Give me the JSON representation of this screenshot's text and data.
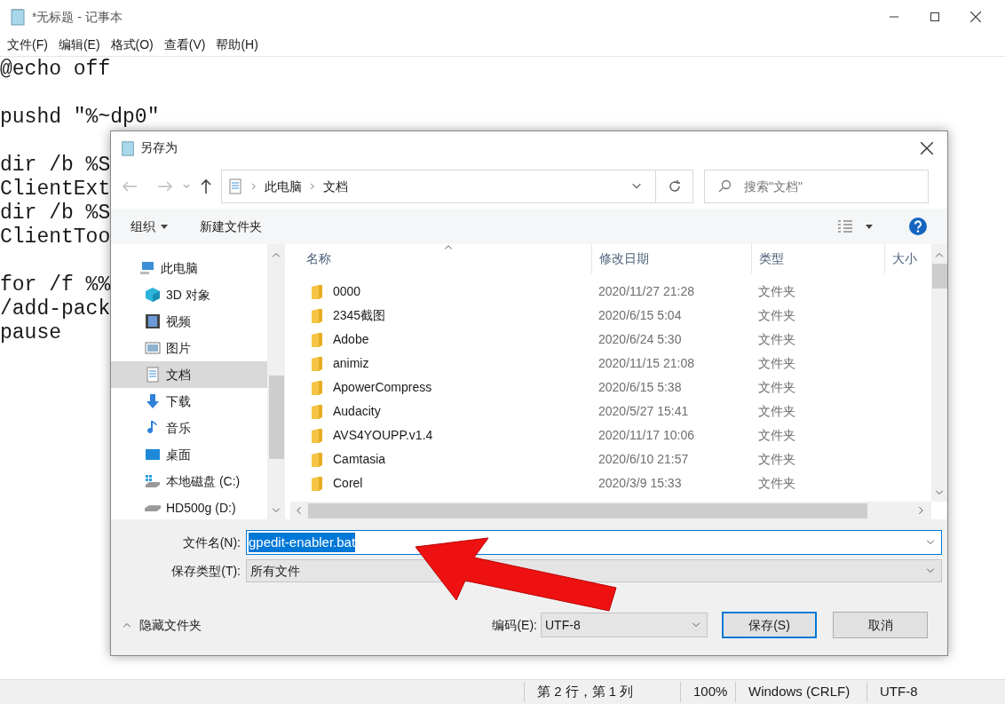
{
  "window": {
    "title": "*无标题 - 记事本"
  },
  "menu": [
    "文件(F)",
    "编辑(E)",
    "格式(O)",
    "查看(V)",
    "帮助(H)"
  ],
  "editor_paragraphs": [
    [
      "@echo off"
    ],
    [
      "pushd \"%~dp0\""
    ],
    [
      "dir /b %S",
      "ClientExt",
      "dir /b %S",
      "ClientToo"
    ],
    [
      "for /f %%",
      "/add-pack",
      "pause"
    ]
  ],
  "status_bar": [
    "第 2 行，第 1 列",
    "100%",
    "Windows (CRLF)",
    "UTF-8"
  ],
  "dialog": {
    "title": "另存为",
    "breadcrumb": [
      "此电脑",
      "文档"
    ],
    "search": {
      "placeholder": "搜索\"文档\""
    },
    "toolbar": {
      "organize": "组织",
      "new_folder": "新建文件夹"
    },
    "nav_items": [
      {
        "label": "此电脑",
        "kind": "pc",
        "selected": false
      },
      {
        "label": "3D 对象",
        "kind": "cube",
        "selected": false
      },
      {
        "label": "视频",
        "kind": "video",
        "selected": false
      },
      {
        "label": "图片",
        "kind": "picture",
        "selected": false
      },
      {
        "label": "文档",
        "kind": "document",
        "selected": true
      },
      {
        "label": "下载",
        "kind": "download",
        "selected": false
      },
      {
        "label": "音乐",
        "kind": "music",
        "selected": false
      },
      {
        "label": "桌面",
        "kind": "desktop",
        "selected": false
      },
      {
        "label": "本地磁盘 (C:)",
        "kind": "system-drive",
        "selected": false
      },
      {
        "label": "HD500g (D:)",
        "kind": "drive",
        "selected": false
      }
    ],
    "columns": [
      "名称",
      "修改日期",
      "类型",
      "大小"
    ],
    "rows": [
      {
        "name": "0000",
        "date": "2020/11/27 21:28",
        "type": "文件夹"
      },
      {
        "name": "2345截图",
        "date": "2020/6/15 5:04",
        "type": "文件夹"
      },
      {
        "name": "Adobe",
        "date": "2020/6/24 5:30",
        "type": "文件夹"
      },
      {
        "name": "animiz",
        "date": "2020/11/15 21:08",
        "type": "文件夹"
      },
      {
        "name": "ApowerCompress",
        "date": "2020/6/15 5:38",
        "type": "文件夹"
      },
      {
        "name": "Audacity",
        "date": "2020/5/27 15:41",
        "type": "文件夹"
      },
      {
        "name": "AVS4YOUPP.v1.4",
        "date": "2020/11/17 10:06",
        "type": "文件夹"
      },
      {
        "name": "Camtasia",
        "date": "2020/6/10 21:57",
        "type": "文件夹"
      },
      {
        "name": "Corel",
        "date": "2020/3/9 15:33",
        "type": "文件夹"
      }
    ],
    "filename": {
      "label": "文件名(N):",
      "value": "gpedit-enabler.bat"
    },
    "filetype": {
      "label": "保存类型(T):",
      "value": "所有文件"
    },
    "hide_folders": "隐藏文件夹",
    "encoding": {
      "label": "编码(E):",
      "value": "UTF-8"
    },
    "buttons": [
      "保存(S)",
      "取消"
    ]
  }
}
